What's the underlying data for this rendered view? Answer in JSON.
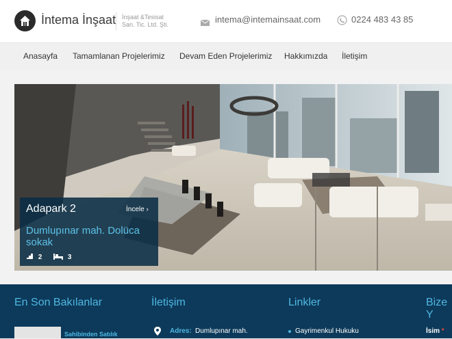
{
  "header": {
    "brand": "İntema İnşaat",
    "subtitle_line1": "İnşaat &Tesisat",
    "subtitle_line2": "San. Tic. Ltd. Şti.",
    "email": "intema@intemainsaat.com",
    "phone": "0224 483 43 85",
    "icons": {
      "logo": "home-icon",
      "mail": "envelope-icon",
      "phone": "phone-icon"
    }
  },
  "nav": {
    "items": [
      "Anasayfa",
      "Tamamlanan Projelerimiz",
      "Devam Eden Projelerimiz",
      "Hakkımızda",
      "İletişim"
    ]
  },
  "hero": {
    "title": "Adapark 2",
    "more": "İncele",
    "address": "Dumlupınar mah. Dolüca sokak",
    "floors": "2",
    "beds": "3"
  },
  "footer": {
    "recent_heading": "En Son Bakılanlar",
    "recent_item": "Sahibinden Satılık",
    "contact_heading": "İletişim",
    "address_label": "Adres:",
    "address_value": "Dumlupınar mah.",
    "links_heading": "Linkler",
    "link_item": "Gayrimenkul Hukuku",
    "form_heading": "Bize Y",
    "name_label": "İsim",
    "name_required": "*"
  },
  "colors": {
    "footer_bg": "#0d3a5a",
    "accent": "#4fb8e3",
    "caption_bg": "#0a2d46"
  }
}
